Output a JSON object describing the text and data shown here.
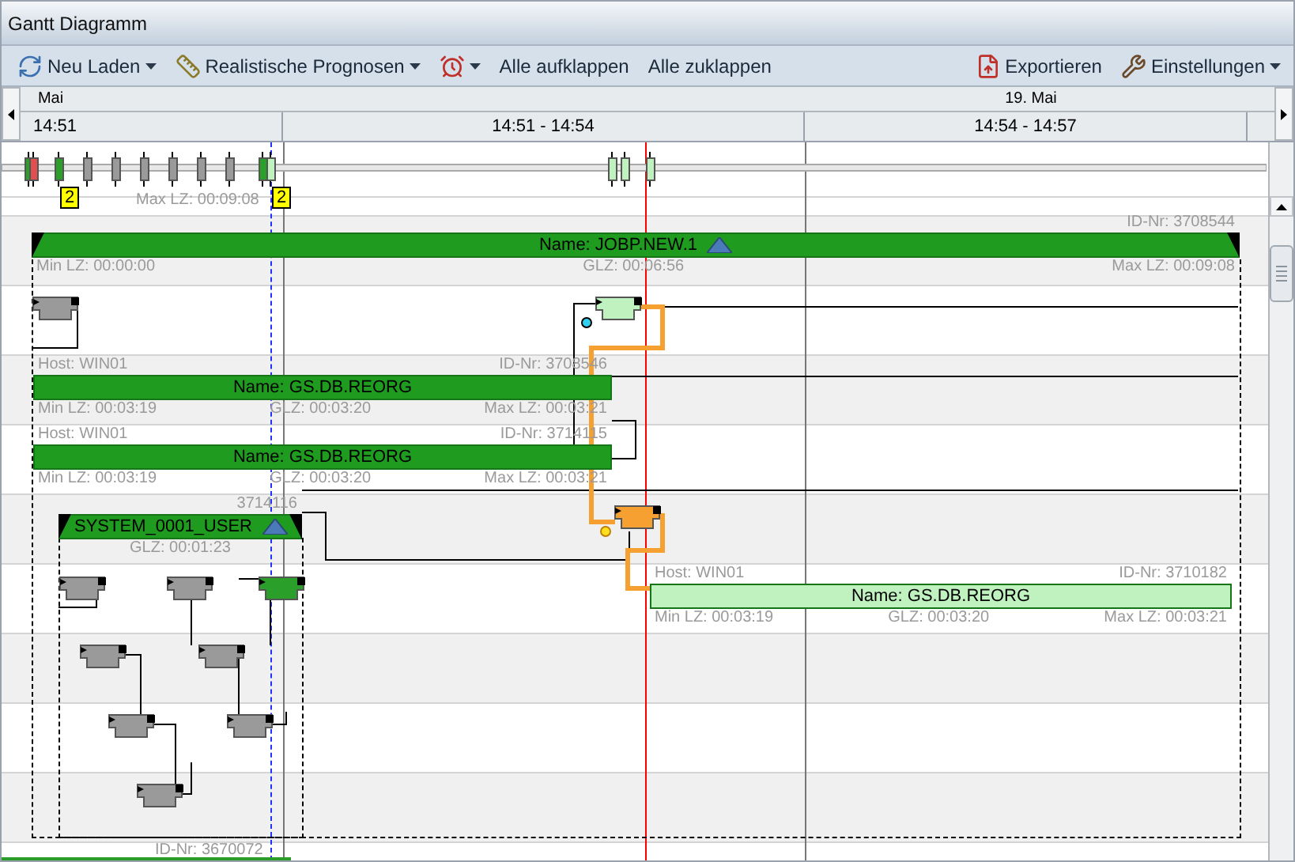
{
  "window": {
    "title": "Gantt Diagramm"
  },
  "toolbar": {
    "left": [
      {
        "label": "Neu Laden",
        "dropdown": true
      },
      {
        "label": "Realistische Prognosen",
        "dropdown": true
      },
      {
        "dropdown": true
      },
      {
        "label": "Alle aufklappen",
        "dropdown": false
      },
      {
        "label": "Alle zuklappen",
        "dropdown": false
      }
    ],
    "right": [
      {
        "label": "Exportieren",
        "dropdown": false
      },
      {
        "label": "Einstellungen",
        "dropdown": true
      }
    ]
  },
  "timeline": {
    "months": [
      "Mai",
      "19. Mai"
    ],
    "periods": [
      "14:51",
      "14:51 - 14:54",
      "14:54 - 14:57"
    ]
  },
  "overview": {
    "badges": [
      "2",
      "2"
    ],
    "partial_label": "Max LZ: 00:09:08"
  },
  "bars": [
    {
      "kind": "group",
      "name": "Name: JOBP.NEW.1",
      "id": "ID-Nr: 3708544",
      "min": "Min LZ: 00:00:00",
      "glz": "GLZ: 00:06:56",
      "max": "Max LZ: 00:09:08",
      "color": "#1f9c1f",
      "expanded": true
    },
    {
      "kind": "task",
      "host": "Host: WIN01",
      "id": "ID-Nr: 3708546",
      "name": "Name: GS.DB.REORG",
      "min": "Min LZ: 00:03:19",
      "glz": "GLZ: 00:03:20",
      "max": "Max LZ: 00:03:21",
      "color": "#1f9c1f"
    },
    {
      "kind": "task",
      "host": "Host: WIN01",
      "id": "ID-Nr: 3714115",
      "name": "Name: GS.DB.REORG",
      "min": "Min LZ: 00:03:19",
      "glz": "GLZ: 00:03:20",
      "max": "Max LZ: 00:03:21",
      "color": "#1f9c1f"
    },
    {
      "kind": "group",
      "name": "SYSTEM_0001_USER",
      "id": "3714116",
      "glz": "GLZ: 00:01:23",
      "color": "#1f9c1f",
      "expanded": true
    },
    {
      "kind": "task",
      "host": "Host: WIN01",
      "id": "ID-Nr: 3710182",
      "name": "Name: GS.DB.REORG",
      "min": "Min LZ: 00:03:19",
      "glz": "GLZ: 00:03:20",
      "max": "Max LZ: 00:03:21",
      "color": "#bff2bf"
    }
  ],
  "footer_label": "ID-Nr: 3670072"
}
